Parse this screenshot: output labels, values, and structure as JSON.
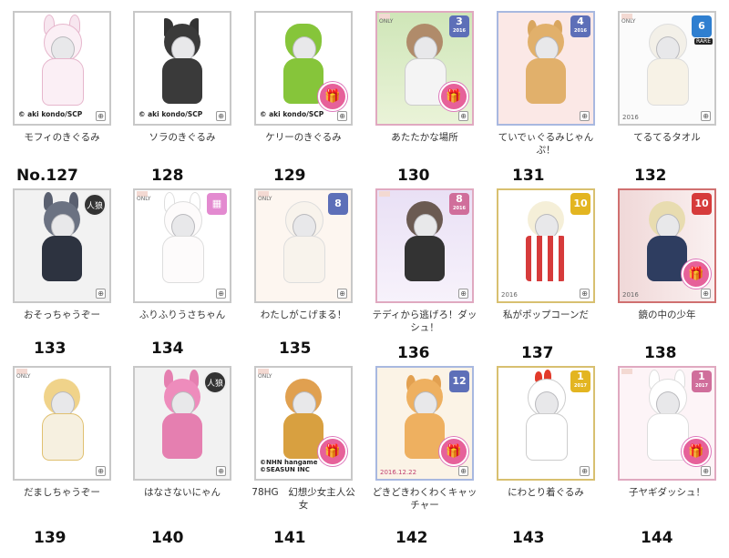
{
  "items": [
    {
      "name": "モフィのきぐるみ",
      "copyright": "© aki kondo/SCP",
      "number": "No.127"
    },
    {
      "name": "ソラのきぐるみ",
      "copyright": "© aki kondo/SCP",
      "number": "128"
    },
    {
      "name": "ケリーのきぐるみ",
      "copyright": "© aki kondo/SCP",
      "number": "129"
    },
    {
      "name": "あたたかな場所",
      "badge": "3",
      "year": "2016",
      "number": "130"
    },
    {
      "name": "ていでぃぐるみじゃんぷ！",
      "badge": "4",
      "year": "2016",
      "number": "131"
    },
    {
      "name": "てるてるタオル",
      "badge": "6",
      "rare": "RARE",
      "year": "2016",
      "number": "132"
    },
    {
      "name": "おそっちゃうぞー",
      "emblem": "人狼",
      "number": "133"
    },
    {
      "name": "ふりふりうさちゃん",
      "number": "134"
    },
    {
      "name": "わたしがこげまる！",
      "badge": "8",
      "number": "135"
    },
    {
      "name": "テディから逃げろ！ダッシュ！",
      "badge": "8",
      "year": "2016",
      "number": "136"
    },
    {
      "name": "私がポップコーンだ",
      "badge": "10",
      "year": "2016",
      "number": "137"
    },
    {
      "name": "鏡の中の少年",
      "badge": "10",
      "year": "2016",
      "number": "138"
    },
    {
      "name": "だましちゃうぞー",
      "number": "139"
    },
    {
      "name": "はなさないにゃん",
      "emblem": "人狼",
      "number": "140"
    },
    {
      "name": "78HG　幻想少女主人公女",
      "copyright": "©NHN hangame ©SEASUN INC",
      "number": "141"
    },
    {
      "name": "どきどきわくわくキャッチャー",
      "badge": "12",
      "year": "2016.12.22",
      "number": "142"
    },
    {
      "name": "にわとり着ぐるみ",
      "badge": "1",
      "year": "2017",
      "number": "143"
    },
    {
      "name": "子ヤギダッシュ！",
      "badge": "1",
      "year": "2017",
      "number": "144"
    }
  ],
  "labels": {
    "only": "ONLY",
    "zoom": "⊕"
  }
}
